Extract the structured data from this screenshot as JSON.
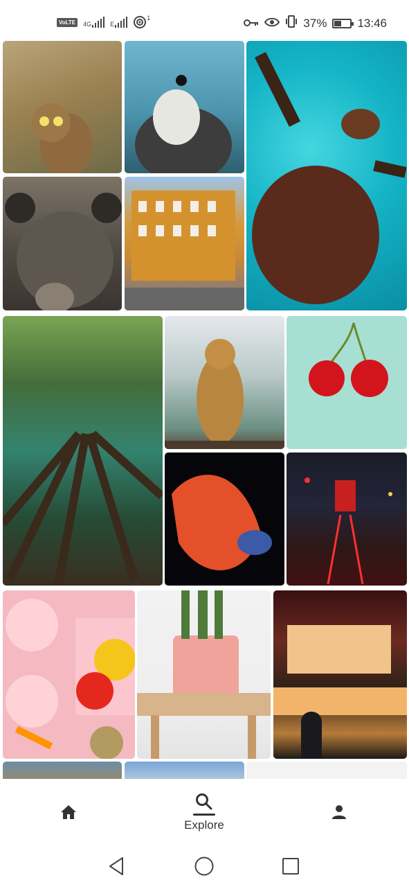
{
  "status_bar": {
    "left_icons": [
      "volte-icon",
      "4g-signal-icon",
      "e-signal-icon",
      "hotspot-icon"
    ],
    "volte_label": "VoLTE",
    "net_4g_label": "4G",
    "net_e_label": "E",
    "hotspot_count": "1",
    "battery_percent": "37%",
    "time": "13:46",
    "right_icons": [
      "key-icon",
      "eye-icon",
      "vibrate-icon",
      "battery-charging-icon"
    ]
  },
  "photos": [
    {
      "subject": "owl"
    },
    {
      "subject": "falcon"
    },
    {
      "subject": "sea turtle"
    },
    {
      "subject": "bear"
    },
    {
      "subject": "orange building"
    },
    {
      "subject": "forest canopy"
    },
    {
      "subject": "lioness"
    },
    {
      "subject": "cherries"
    },
    {
      "subject": "betta fish"
    },
    {
      "subject": "night tram street"
    },
    {
      "subject": "vegetables on pink"
    },
    {
      "subject": "potted plant on stool"
    },
    {
      "subject": "japanese night restaurant"
    },
    {
      "subject": "bird"
    },
    {
      "subject": "sky"
    },
    {
      "subject": "blank"
    }
  ],
  "bottom_nav": {
    "home_icon": "home-icon",
    "explore_icon": "search-icon",
    "explore_label": "Explore",
    "profile_icon": "person-icon"
  },
  "system_nav": [
    "back-icon",
    "home-circle-icon",
    "recents-icon"
  ]
}
